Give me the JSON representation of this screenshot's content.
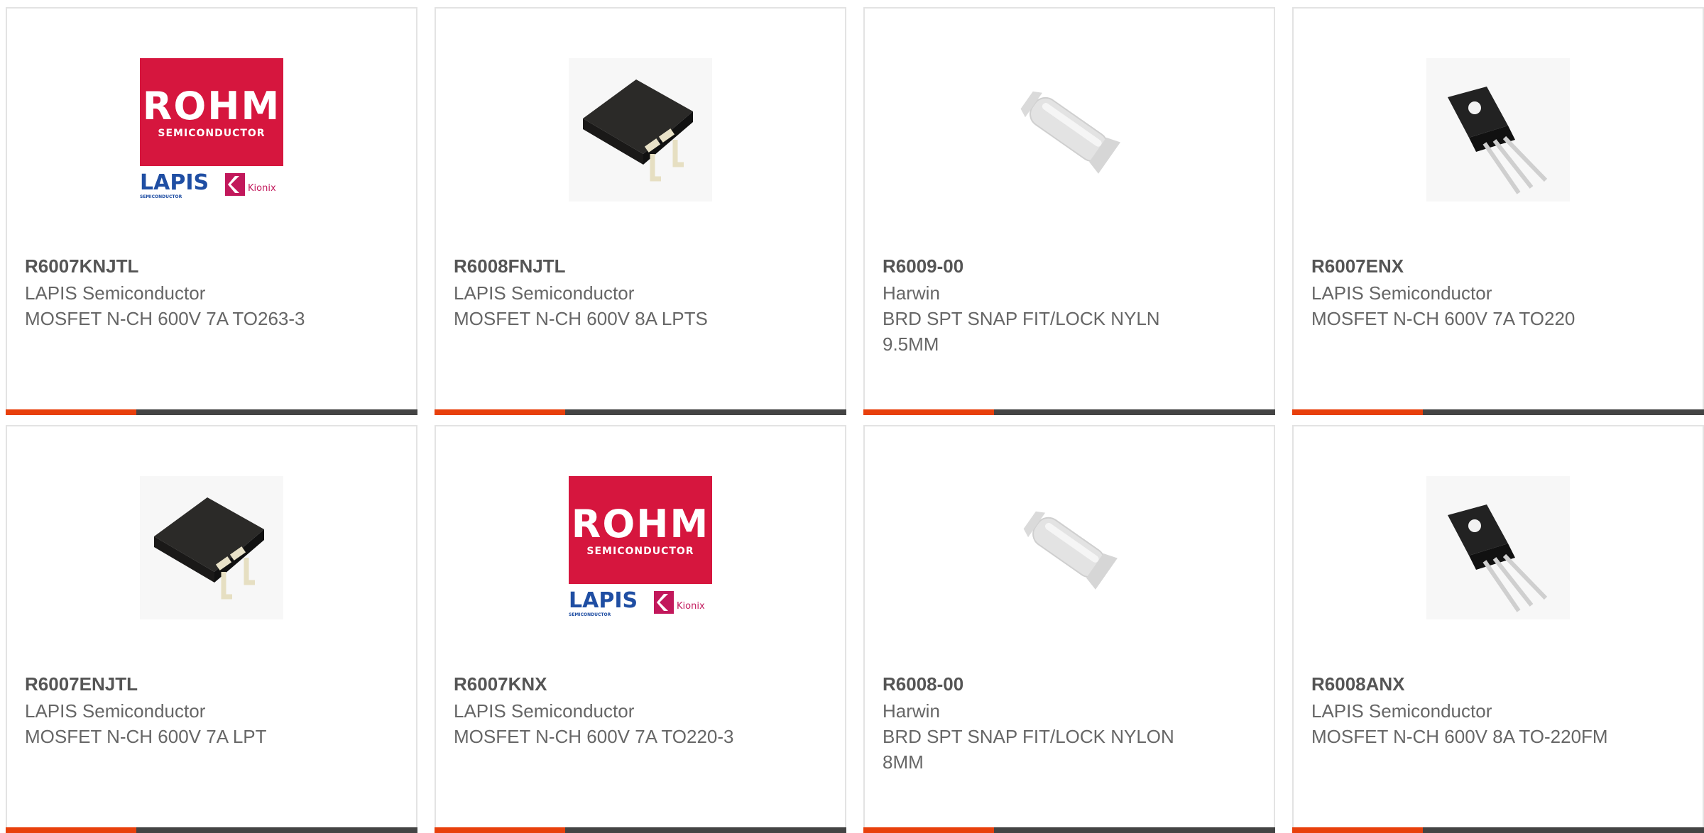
{
  "products": [
    {
      "part": "R6007KNJTL",
      "manufacturer": "LAPIS Semiconductor",
      "description": "MOSFET N-CH 600V 7A TO263-3",
      "image": "rohm-logo"
    },
    {
      "part": "R6008FNJTL",
      "manufacturer": "LAPIS Semiconductor",
      "description": "MOSFET N-CH 600V 8A LPTS",
      "image": "d2pak-package"
    },
    {
      "part": "R6009-00",
      "manufacturer": "Harwin",
      "description": "BRD SPT SNAP FIT/LOCK NYLN 9.5MM",
      "image": "nylon-spacer"
    },
    {
      "part": "R6007ENX",
      "manufacturer": "LAPIS Semiconductor",
      "description": "MOSFET N-CH 600V 7A TO220",
      "image": "to220-package"
    },
    {
      "part": "R6007ENJTL",
      "manufacturer": "LAPIS Semiconductor",
      "description": "MOSFET N-CH 600V 7A LPT",
      "image": "d2pak-package"
    },
    {
      "part": "R6007KNX",
      "manufacturer": "LAPIS Semiconductor",
      "description": "MOSFET N-CH 600V 7A TO220-3",
      "image": "rohm-logo"
    },
    {
      "part": "R6008-00",
      "manufacturer": "Harwin",
      "description": "BRD SPT SNAP FIT/LOCK NYLON 8MM",
      "image": "nylon-spacer"
    },
    {
      "part": "R6008ANX",
      "manufacturer": "LAPIS Semiconductor",
      "description": "MOSFET N-CH 600V 8A TO-220FM",
      "image": "to220-package"
    }
  ],
  "logo_text": {
    "brand": "ROHM",
    "brand_sub": "SEMICONDUCTOR",
    "lapis": "LAPIS",
    "lapis_sub": "SEMICONDUCTOR",
    "kionix": "Kionix"
  },
  "colors": {
    "accent": "#e8400c",
    "bar": "#444444",
    "rohm_red": "#d6163e"
  }
}
